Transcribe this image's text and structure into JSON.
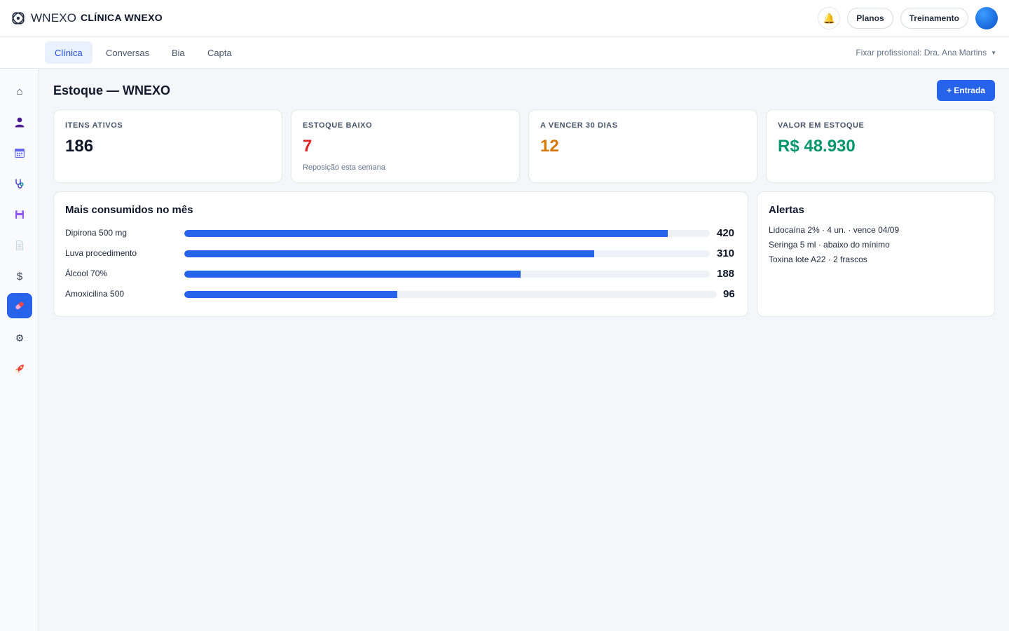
{
  "header": {
    "logo_text": "WNEXO",
    "clinic_name": "CLÍNICA WNEXO",
    "plans_label": "Planos",
    "training_label": "Treinamento"
  },
  "nav": {
    "tabs": [
      {
        "label": "Clínica",
        "active": true
      },
      {
        "label": "Conversas",
        "active": false
      },
      {
        "label": "Bia",
        "active": false
      },
      {
        "label": "Capta",
        "active": false
      }
    ],
    "fix_professional": "Fixar profissional: Dra. Ana Martins"
  },
  "sidebar": {
    "items": [
      "home-icon",
      "user-icon",
      "calendar-icon",
      "stethoscope-icon",
      "save-icon",
      "document-icon",
      "dollar-icon",
      "pill-icon",
      "gear-icon",
      "rocket-icon"
    ],
    "active_index": 7
  },
  "page": {
    "title": "Estoque — WNEXO",
    "entry_button": "+ Entrada"
  },
  "kpis": [
    {
      "label": "ITENS ATIVOS",
      "value": "186",
      "sub": "",
      "color": "#0f172a"
    },
    {
      "label": "ESTOQUE BAIXO",
      "value": "7",
      "sub": "Reposição esta semana",
      "color": "#dc2626"
    },
    {
      "label": "A VENCER 30 DIAS",
      "value": "12",
      "sub": "",
      "color": "#d97706"
    },
    {
      "label": "VALOR EM ESTOQUE",
      "value": "R$ 48.930",
      "sub": "",
      "color": "#059669"
    }
  ],
  "consumption": {
    "title": "Mais consumidos no mês",
    "items": [
      {
        "label": "Dipirona 500 mg",
        "value": 420,
        "display": "420",
        "fraction": 0.92
      },
      {
        "label": "Luva procedimento",
        "value": 310,
        "display": "310",
        "fraction": 0.78
      },
      {
        "label": "Álcool 70%",
        "value": 188,
        "display": "188",
        "fraction": 0.64
      },
      {
        "label": "Amoxicilina 500",
        "value": 96,
        "display": "96",
        "fraction": 0.4
      }
    ]
  },
  "alerts": {
    "title": "Alertas",
    "items": [
      "Lidocaína 2% · 4 un. · vence 04/09",
      "Seringa 5 ml · abaixo do mínimo",
      "Toxina lote A22 · 2 frascos"
    ]
  },
  "colors": {
    "accent": "#2563eb",
    "danger": "#dc2626",
    "warning": "#d97706",
    "success": "#059669"
  }
}
